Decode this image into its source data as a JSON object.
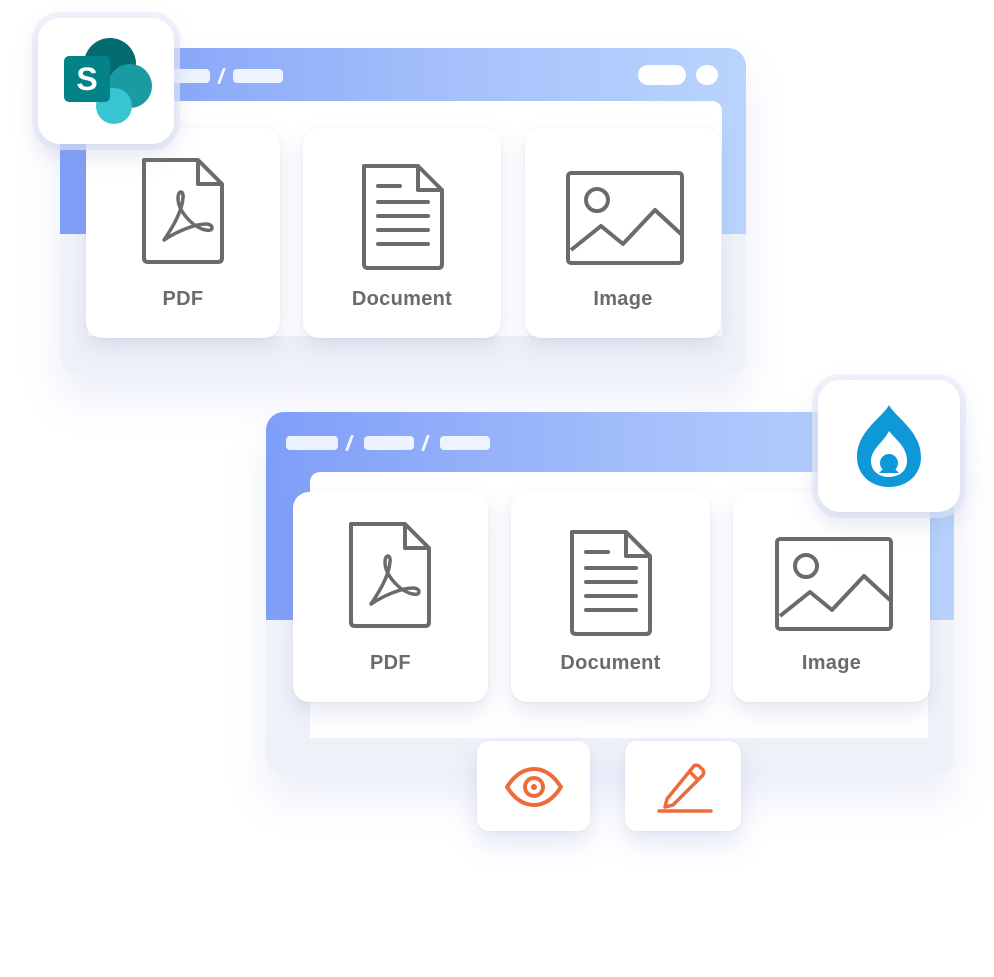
{
  "colors": {
    "titlebar_start": "#7f9ef8",
    "titlebar_end": "#b9d4fd",
    "icon_gray": "#6b6b6b",
    "action_orange": "#ee6b3b",
    "sharepoint_teal": "#038387",
    "drupal_blue": "#0e98d8"
  },
  "sharepoint_window": {
    "app_badge": {
      "icon": "sharepoint-logo",
      "letter": "S"
    },
    "files": [
      {
        "icon": "pdf-file-icon",
        "label": "PDF"
      },
      {
        "icon": "document-file-icon",
        "label": "Document"
      },
      {
        "icon": "image-file-icon",
        "label": "Image"
      }
    ]
  },
  "drupal_window": {
    "app_badge": {
      "icon": "drupal-logo"
    },
    "files": [
      {
        "icon": "pdf-file-icon",
        "label": "PDF"
      },
      {
        "icon": "document-file-icon",
        "label": "Document"
      },
      {
        "icon": "image-file-icon",
        "label": "Image"
      }
    ],
    "actions": [
      {
        "icon": "eye-icon",
        "name": "view"
      },
      {
        "icon": "pencil-icon",
        "name": "edit"
      }
    ]
  }
}
